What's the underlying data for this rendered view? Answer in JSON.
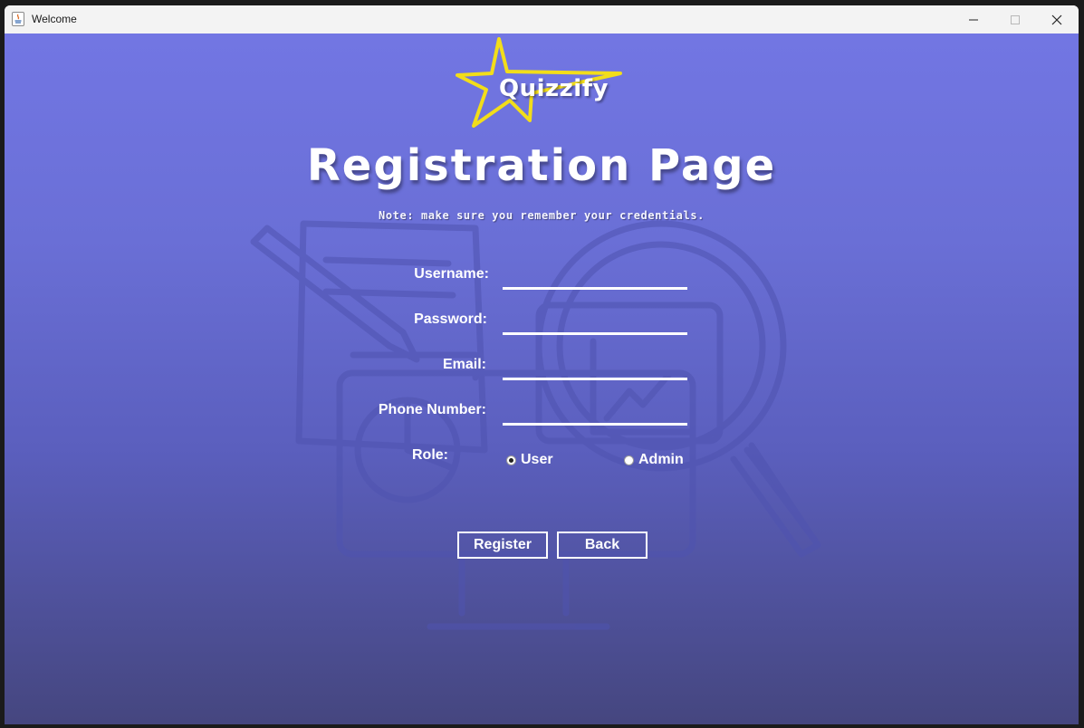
{
  "window": {
    "title": "Welcome",
    "controls": [
      "minimize",
      "maximize",
      "close"
    ]
  },
  "logo": {
    "text": "Quizzify",
    "star_color": "#f2dd1a"
  },
  "page": {
    "title": "Registration Page",
    "note": "Note: make sure you remember your credentials."
  },
  "form": {
    "username_label": "Username:",
    "username_value": "",
    "password_label": "Password:",
    "password_value": "",
    "email_label": "Email:",
    "email_value": "",
    "phone_label": "Phone Number:",
    "phone_value": "",
    "role_label": "Role:",
    "roles": [
      {
        "label": "User",
        "checked": true
      },
      {
        "label": "Admin",
        "checked": false
      }
    ]
  },
  "buttons": {
    "register": "Register",
    "back": "Back"
  },
  "colors": {
    "gradient_top": "#7276e3",
    "gradient_bottom": "#45467f",
    "text": "#ffffff"
  }
}
